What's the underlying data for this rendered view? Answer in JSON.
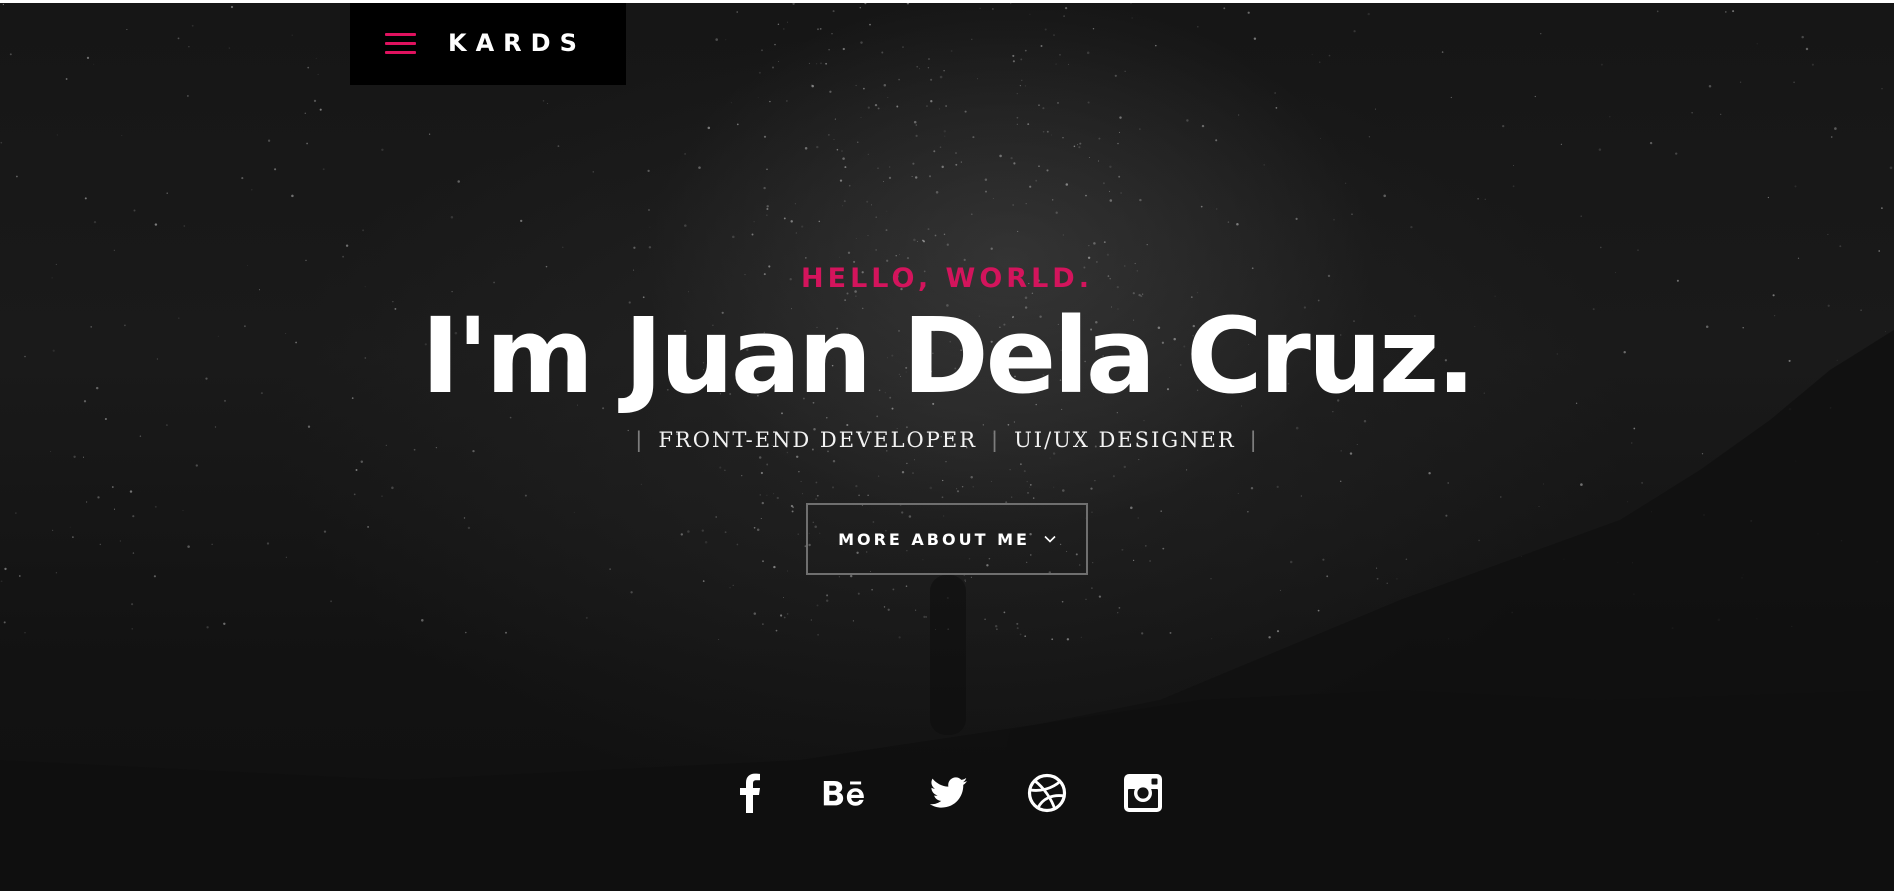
{
  "brand": {
    "name": "KARDS",
    "menu_icon": "hamburger-menu-icon",
    "accent_color": "#e0125f"
  },
  "hero": {
    "greeting": "HELLO, WORLD.",
    "headline": "I'm Juan Dela Cruz.",
    "roles": [
      "FRONT-END DEVELOPER",
      "UI/UX DESIGNER"
    ],
    "role_separator": "|",
    "cta_label": "MORE ABOUT ME",
    "cta_icon": "chevron-down-icon"
  },
  "social": [
    {
      "name": "facebook",
      "icon": "facebook-icon"
    },
    {
      "name": "behance",
      "icon": "behance-icon"
    },
    {
      "name": "twitter",
      "icon": "twitter-icon"
    },
    {
      "name": "dribbble",
      "icon": "dribbble-icon"
    },
    {
      "name": "instagram",
      "icon": "instagram-icon"
    }
  ],
  "colors": {
    "background": "#121212",
    "accent": "#d3145c",
    "text": "#ffffff",
    "button_border": "#6f6f6f"
  }
}
